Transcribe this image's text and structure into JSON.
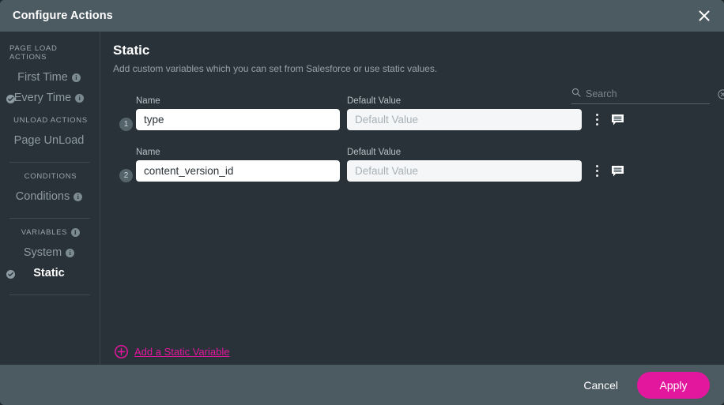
{
  "titlebar": {
    "title": "Configure Actions",
    "close_icon": "close-icon"
  },
  "sidebar": {
    "groups": [
      {
        "label": "PAGE LOAD ACTIONS",
        "has_info": false,
        "items": [
          {
            "label": "First Time",
            "active": false,
            "checked": false,
            "has_info": true
          },
          {
            "label": "Every Time",
            "active": false,
            "checked": true,
            "has_info": true
          }
        ]
      },
      {
        "label": "UNLOAD ACTIONS",
        "has_info": false,
        "items": [
          {
            "label": "Page UnLoad",
            "active": false,
            "checked": false,
            "has_info": false
          }
        ]
      },
      {
        "label": "CONDITIONS",
        "has_info": false,
        "items": [
          {
            "label": "Conditions",
            "active": false,
            "checked": false,
            "has_info": true
          }
        ]
      },
      {
        "label": "VARIABLES",
        "has_info": true,
        "items": [
          {
            "label": "System",
            "active": false,
            "checked": false,
            "has_info": true
          },
          {
            "label": "Static",
            "active": true,
            "checked": true,
            "has_info": false
          }
        ]
      }
    ]
  },
  "main": {
    "title": "Static",
    "subtitle": "Add custom variables which you can set from Salesforce or use static values.",
    "search": {
      "placeholder": "Search",
      "value": "",
      "search_icon": "search-icon",
      "clear_icon": "clear-circle-icon"
    },
    "column_headers": {
      "name": "Name",
      "default_value": "Default Value"
    },
    "rows": [
      {
        "index": "1",
        "name_value": "type",
        "default_placeholder": "Default Value",
        "default_value": "",
        "menu_icon": "kebab-menu-icon",
        "note_icon": "comment-icon"
      },
      {
        "index": "2",
        "name_value": "content_version_id",
        "default_placeholder": "Default Value",
        "default_value": "",
        "menu_icon": "kebab-menu-icon",
        "note_icon": "comment-icon"
      }
    ],
    "add_link": {
      "label": "Add a Static Variable",
      "icon": "plus-circle-icon"
    }
  },
  "footer": {
    "cancel_label": "Cancel",
    "apply_label": "Apply"
  },
  "colors": {
    "accent": "#e3179e",
    "titlebar": "#4c5a61",
    "panel": "#283238"
  }
}
